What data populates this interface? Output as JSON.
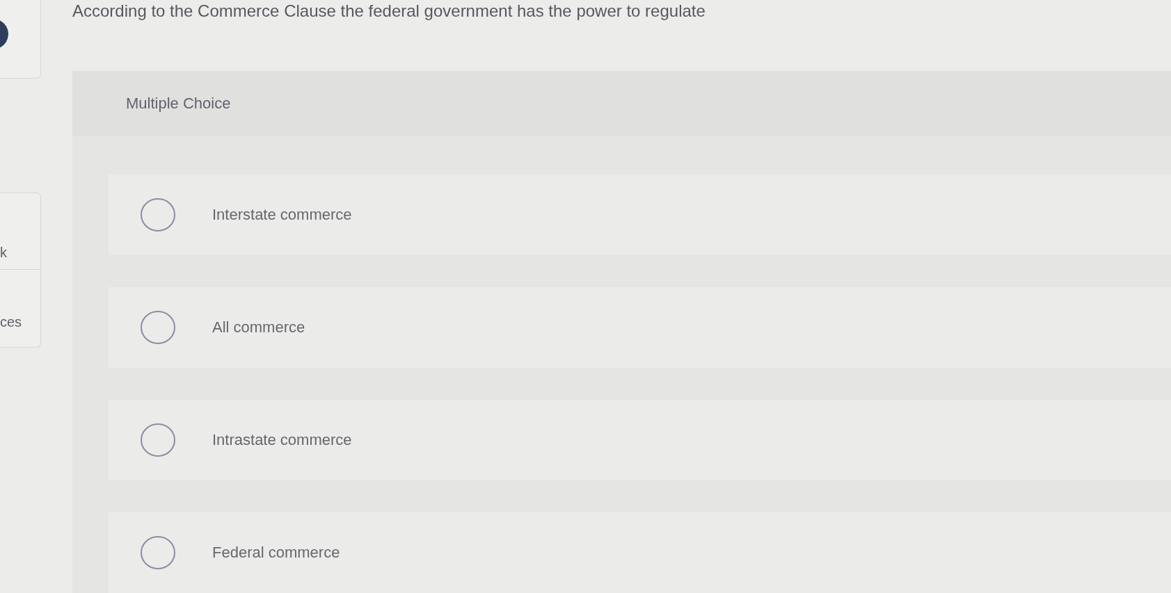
{
  "question": {
    "text": "According to the Commerce Clause the federal government has the power to regulate"
  },
  "sidebar": {
    "items": [
      {
        "label": "k"
      },
      {
        "label": "ces"
      }
    ]
  },
  "section_title": "Multiple Choice",
  "options": [
    {
      "label": "Interstate commerce",
      "selected": false
    },
    {
      "label": "All commerce",
      "selected": false
    },
    {
      "label": "Intrastate commerce",
      "selected": false
    },
    {
      "label": "Federal commerce",
      "selected": false
    }
  ]
}
